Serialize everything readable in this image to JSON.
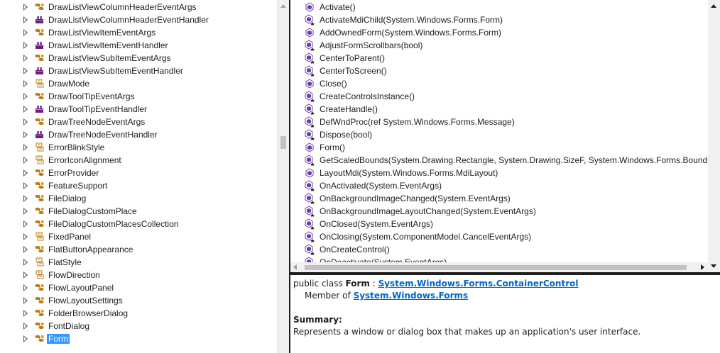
{
  "tree": {
    "items": [
      {
        "label": "DrawListViewColumnHeaderEventArgs",
        "icon": "class-icon"
      },
      {
        "label": "DrawListViewColumnHeaderEventHandler",
        "icon": "delegate-icon"
      },
      {
        "label": "DrawListViewItemEventArgs",
        "icon": "class-icon"
      },
      {
        "label": "DrawListViewItemEventHandler",
        "icon": "delegate-icon"
      },
      {
        "label": "DrawListViewSubItemEventArgs",
        "icon": "class-icon"
      },
      {
        "label": "DrawListViewSubItemEventHandler",
        "icon": "delegate-icon"
      },
      {
        "label": "DrawMode",
        "icon": "enum-icon"
      },
      {
        "label": "DrawToolTipEventArgs",
        "icon": "class-icon"
      },
      {
        "label": "DrawToolTipEventHandler",
        "icon": "delegate-icon"
      },
      {
        "label": "DrawTreeNodeEventArgs",
        "icon": "class-icon"
      },
      {
        "label": "DrawTreeNodeEventHandler",
        "icon": "delegate-icon"
      },
      {
        "label": "ErrorBlinkStyle",
        "icon": "enum-icon"
      },
      {
        "label": "ErrorIconAlignment",
        "icon": "enum-icon"
      },
      {
        "label": "ErrorProvider",
        "icon": "class-icon"
      },
      {
        "label": "FeatureSupport",
        "icon": "class-icon"
      },
      {
        "label": "FileDialog",
        "icon": "class-icon"
      },
      {
        "label": "FileDialogCustomPlace",
        "icon": "class-icon"
      },
      {
        "label": "FileDialogCustomPlacesCollection",
        "icon": "class-icon"
      },
      {
        "label": "FixedPanel",
        "icon": "enum-icon"
      },
      {
        "label": "FlatButtonAppearance",
        "icon": "class-icon"
      },
      {
        "label": "FlatStyle",
        "icon": "enum-icon"
      },
      {
        "label": "FlowDirection",
        "icon": "enum-icon"
      },
      {
        "label": "FlowLayoutPanel",
        "icon": "class-icon"
      },
      {
        "label": "FlowLayoutSettings",
        "icon": "class-icon"
      },
      {
        "label": "FolderBrowserDialog",
        "icon": "class-icon"
      },
      {
        "label": "FontDialog",
        "icon": "class-icon"
      },
      {
        "label": "Form",
        "icon": "class-icon",
        "selected": true
      }
    ]
  },
  "members": {
    "items": [
      {
        "label": "Activate()",
        "icon": "method-icon"
      },
      {
        "label": "ActivateMdiChild(System.Windows.Forms.Form)",
        "icon": "protected-method-icon"
      },
      {
        "label": "AddOwnedForm(System.Windows.Forms.Form)",
        "icon": "method-icon"
      },
      {
        "label": "AdjustFormScrollbars(bool)",
        "icon": "protected-method-icon"
      },
      {
        "label": "CenterToParent()",
        "icon": "protected-method-icon"
      },
      {
        "label": "CenterToScreen()",
        "icon": "protected-method-icon"
      },
      {
        "label": "Close()",
        "icon": "method-icon"
      },
      {
        "label": "CreateControlsInstance()",
        "icon": "protected-method-icon"
      },
      {
        "label": "CreateHandle()",
        "icon": "protected-method-icon"
      },
      {
        "label": "DefWndProc(ref System.Windows.Forms.Message)",
        "icon": "protected-method-icon"
      },
      {
        "label": "Dispose(bool)",
        "icon": "protected-method-icon"
      },
      {
        "label": "Form()",
        "icon": "method-icon"
      },
      {
        "label": "GetScaledBounds(System.Drawing.Rectangle, System.Drawing.SizeF, System.Windows.Forms.BoundsSpecif",
        "icon": "protected-method-icon"
      },
      {
        "label": "LayoutMdi(System.Windows.Forms.MdiLayout)",
        "icon": "method-icon"
      },
      {
        "label": "OnActivated(System.EventArgs)",
        "icon": "protected-method-icon"
      },
      {
        "label": "OnBackgroundImageChanged(System.EventArgs)",
        "icon": "protected-method-icon"
      },
      {
        "label": "OnBackgroundImageLayoutChanged(System.EventArgs)",
        "icon": "protected-method-icon"
      },
      {
        "label": "OnClosed(System.EventArgs)",
        "icon": "protected-method-icon"
      },
      {
        "label": "OnClosing(System.ComponentModel.CancelEventArgs)",
        "icon": "protected-method-icon"
      },
      {
        "label": "OnCreateControl()",
        "icon": "protected-method-icon"
      },
      {
        "label": "OnDeactivate(System.EventArgs)",
        "icon": "protected-method-icon"
      }
    ]
  },
  "description": {
    "declaration_prefix": "public class ",
    "class_name": "Form",
    "separator": " : ",
    "base_class": "System.Windows.Forms.ContainerControl",
    "member_of_prefix": "Member of ",
    "namespace": "System.Windows.Forms",
    "summary_heading": "Summary:",
    "summary_text": "Represents a window or dialog box that makes up an application's user interface."
  },
  "colors": {
    "selection": "#3399ff",
    "link": "#0066cc",
    "class_icon": "#c27d0e",
    "delegate_icon": "#68217a",
    "method_icon": "#6c3fa6"
  }
}
